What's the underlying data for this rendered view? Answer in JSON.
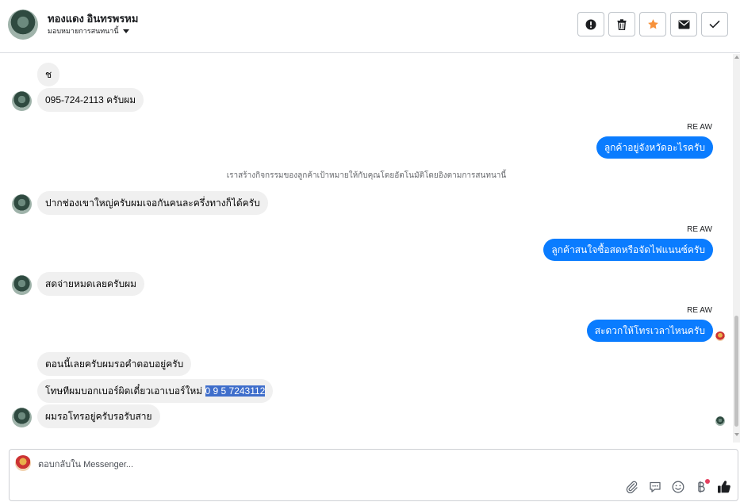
{
  "header": {
    "contact_name": "ทองแดง อินทรพรหม",
    "assign_label": "มอบหมายการสนทนานี้",
    "actions": [
      {
        "icon": "alert-icon"
      },
      {
        "icon": "trash-icon"
      },
      {
        "icon": "star-icon",
        "color": "#f7923b"
      },
      {
        "icon": "envelope-icon"
      },
      {
        "icon": "check-icon"
      }
    ]
  },
  "thread": {
    "messages": [
      {
        "side": "in",
        "text": "ช"
      },
      {
        "side": "in",
        "text": "095-724-2113 ครับผม"
      },
      {
        "side": "out",
        "sender": "RE AW",
        "text": "ลูกค้าอยู่จังหวัดอะไรครับ"
      },
      {
        "side": "system",
        "text": "เราสร้างกิจกรรมของลูกค้าเป้าหมายให้กับคุณโดยอัตโนมัติโดยอิงตามการสนทนานี้"
      },
      {
        "side": "in",
        "text": "ปากช่องเขาใหญ่ครับผมเจอกันคนละครึ่งทางก็ได้ครับ"
      },
      {
        "side": "out",
        "sender": "RE AW",
        "text": "ลูกค้าสนใจซื้อสดหรือจัดไฟแนนซ์ครับ"
      },
      {
        "side": "in",
        "text": "สดจ่ายหมดเลยครับผม"
      },
      {
        "side": "out",
        "sender": "RE AW",
        "text": "สะดวกให้โทรเวลาไหนครับ"
      },
      {
        "side": "in",
        "text": "ตอนนี้เลยครับผมรอคำตอบอยู่ครับ"
      },
      {
        "side": "in",
        "text_before": "โทษทีผมบอกเบอร์ผิดเดี๋ยวเอาเบอร์ใหม่ ",
        "text_highlighted": "0 9 5 7243112"
      },
      {
        "side": "in",
        "text": "ผมรอโทรอยู่ครับรอรับสาย"
      }
    ]
  },
  "composer": {
    "placeholder": "ตอบกลับใน Messenger...",
    "tools": [
      {
        "icon": "paperclip-icon"
      },
      {
        "icon": "saved-reply-icon"
      },
      {
        "icon": "emoji-icon"
      },
      {
        "icon": "payment-icon",
        "badge_color": "#e4405f"
      },
      {
        "icon": "thumbs-up-icon"
      }
    ]
  },
  "colors": {
    "outgoing_bubble": "#0a7cff",
    "incoming_bubble": "#f0f0f0",
    "highlight": "#3f6ecb"
  }
}
